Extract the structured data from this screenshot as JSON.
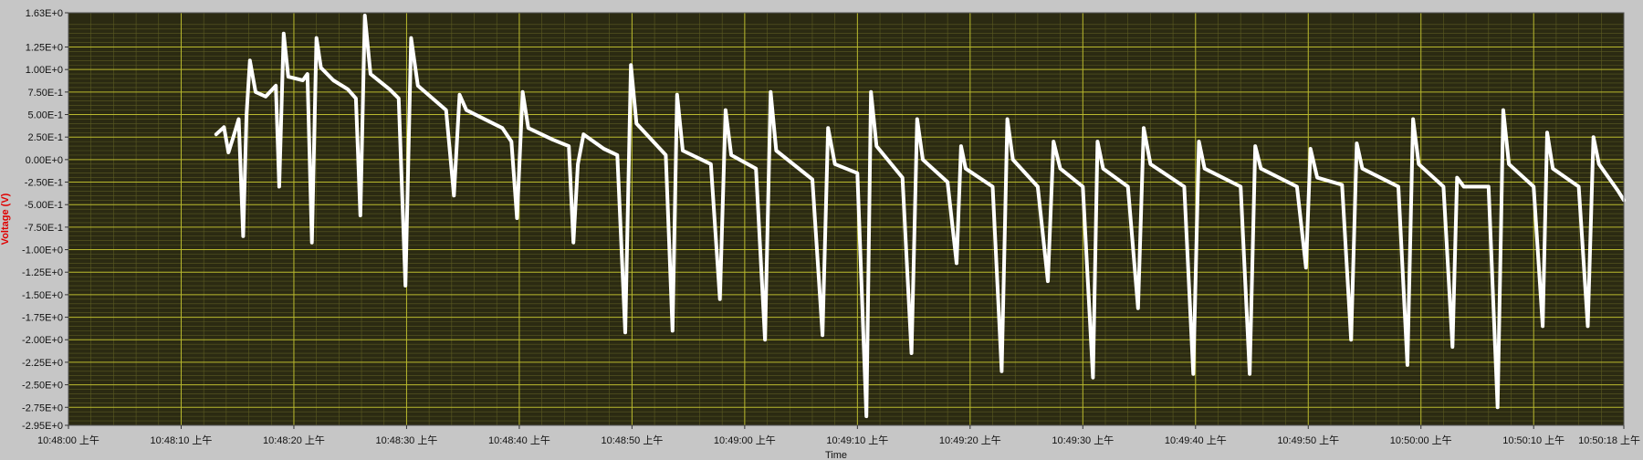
{
  "chart_data": {
    "type": "line",
    "title": "",
    "xlabel": "Time",
    "ylabel": "Voltage (V)",
    "ylim": [
      -2.95,
      1.63
    ],
    "xlim": [
      "10:48:00 上午",
      "10:50:18 上午"
    ],
    "grid": true,
    "legend": "none",
    "y_tick_values": [
      1.63,
      1.25,
      1.0,
      0.75,
      0.5,
      0.25,
      0.0,
      -0.25,
      -0.5,
      -0.75,
      -1.0,
      -1.25,
      -1.5,
      -1.75,
      -2.0,
      -2.25,
      -2.5,
      -2.75,
      -2.95
    ],
    "y_tick_labels": [
      "1.63E+0",
      "1.25E+0",
      "1.00E+0",
      "7.50E-1",
      "5.00E-1",
      "2.50E-1",
      "0.00E+0",
      "-2.50E-1",
      "-5.00E-1",
      "-7.50E-1",
      "-1.00E+0",
      "-1.25E+0",
      "-1.50E+0",
      "-1.75E+0",
      "-2.00E+0",
      "-2.25E+0",
      "-2.50E+0",
      "-2.75E+0",
      "-2.95E+0"
    ],
    "x_tick_labels": [
      "10:48:00 上午",
      "10:48:10 上午",
      "10:48:20 上午",
      "10:48:30 上午",
      "10:48:40 上午",
      "10:48:50 上午",
      "10:49:00 上午",
      "10:49:10 上午",
      "10:49:20 上午",
      "10:49:30 上午",
      "10:49:40 上午",
      "10:49:50 上午",
      "10:50:00 上午",
      "10:50:10 上午",
      "10:50:18 上午"
    ],
    "x_tick_seconds": [
      0,
      10,
      20,
      30,
      40,
      50,
      60,
      70,
      80,
      90,
      100,
      110,
      120,
      130,
      138
    ],
    "series": [
      {
        "color": "#ffffff",
        "start_value": 0.3,
        "end_value": -0.45,
        "points": [
          [
            13.1,
            0.28
          ],
          [
            13.8,
            0.36
          ],
          [
            14.2,
            0.08
          ],
          [
            14.6,
            0.24
          ],
          [
            15.1,
            0.45
          ],
          [
            15.5,
            -0.85
          ],
          [
            15.8,
            0.5
          ],
          [
            16.1,
            1.1
          ],
          [
            16.6,
            0.75
          ],
          [
            17.5,
            0.7
          ],
          [
            18.4,
            0.82
          ],
          [
            18.7,
            -0.3
          ],
          [
            19.1,
            1.4
          ],
          [
            19.5,
            0.92
          ],
          [
            20.8,
            0.88
          ],
          [
            21.2,
            0.95
          ],
          [
            21.6,
            -0.92
          ],
          [
            22.0,
            1.35
          ],
          [
            22.4,
            1.02
          ],
          [
            23.5,
            0.88
          ],
          [
            24.8,
            0.78
          ],
          [
            25.5,
            0.68
          ],
          [
            25.9,
            -0.62
          ],
          [
            26.3,
            1.6
          ],
          [
            26.8,
            0.95
          ],
          [
            28.5,
            0.78
          ],
          [
            29.3,
            0.68
          ],
          [
            29.9,
            -1.4
          ],
          [
            30.4,
            1.35
          ],
          [
            31.0,
            0.82
          ],
          [
            33.5,
            0.55
          ],
          [
            34.2,
            -0.4
          ],
          [
            34.7,
            0.72
          ],
          [
            35.3,
            0.55
          ],
          [
            38.5,
            0.35
          ],
          [
            39.3,
            0.2
          ],
          [
            39.8,
            -0.65
          ],
          [
            40.3,
            0.75
          ],
          [
            40.8,
            0.35
          ],
          [
            43.0,
            0.22
          ],
          [
            44.4,
            0.15
          ],
          [
            44.8,
            -0.92
          ],
          [
            45.2,
            -0.05
          ],
          [
            45.7,
            0.28
          ],
          [
            47.5,
            0.12
          ],
          [
            48.7,
            0.05
          ],
          [
            49.4,
            -1.92
          ],
          [
            49.9,
            1.05
          ],
          [
            50.4,
            0.4
          ],
          [
            53.0,
            0.05
          ],
          [
            53.6,
            -1.9
          ],
          [
            54.0,
            0.72
          ],
          [
            54.5,
            0.1
          ],
          [
            57.0,
            -0.05
          ],
          [
            57.8,
            -1.55
          ],
          [
            58.3,
            0.55
          ],
          [
            58.8,
            0.05
          ],
          [
            61.0,
            -0.1
          ],
          [
            61.8,
            -2.0
          ],
          [
            62.3,
            0.75
          ],
          [
            62.8,
            0.1
          ],
          [
            66.0,
            -0.22
          ],
          [
            66.9,
            -1.95
          ],
          [
            67.4,
            0.35
          ],
          [
            68.0,
            -0.05
          ],
          [
            70.0,
            -0.15
          ],
          [
            70.8,
            -2.85
          ],
          [
            71.2,
            0.75
          ],
          [
            71.7,
            0.15
          ],
          [
            74.0,
            -0.2
          ],
          [
            74.8,
            -2.15
          ],
          [
            75.3,
            0.45
          ],
          [
            75.8,
            0.0
          ],
          [
            78.0,
            -0.25
          ],
          [
            78.8,
            -1.15
          ],
          [
            79.2,
            0.15
          ],
          [
            79.6,
            -0.1
          ],
          [
            82.0,
            -0.3
          ],
          [
            82.8,
            -2.35
          ],
          [
            83.3,
            0.45
          ],
          [
            83.8,
            0.0
          ],
          [
            86.0,
            -0.3
          ],
          [
            86.9,
            -1.35
          ],
          [
            87.4,
            0.2
          ],
          [
            88.0,
            -0.1
          ],
          [
            90.0,
            -0.3
          ],
          [
            90.9,
            -2.42
          ],
          [
            91.3,
            0.2
          ],
          [
            91.8,
            -0.1
          ],
          [
            94.0,
            -0.3
          ],
          [
            94.9,
            -1.65
          ],
          [
            95.4,
            0.35
          ],
          [
            96.0,
            -0.05
          ],
          [
            99.0,
            -0.3
          ],
          [
            99.8,
            -2.38
          ],
          [
            100.3,
            0.2
          ],
          [
            100.8,
            -0.1
          ],
          [
            104.0,
            -0.3
          ],
          [
            104.8,
            -2.38
          ],
          [
            105.3,
            0.15
          ],
          [
            105.8,
            -0.1
          ],
          [
            109.0,
            -0.3
          ],
          [
            109.8,
            -1.2
          ],
          [
            110.2,
            0.12
          ],
          [
            110.8,
            -0.2
          ],
          [
            113.0,
            -0.28
          ],
          [
            113.8,
            -2.0
          ],
          [
            114.3,
            0.18
          ],
          [
            114.8,
            -0.1
          ],
          [
            118.0,
            -0.3
          ],
          [
            118.8,
            -2.28
          ],
          [
            119.3,
            0.45
          ],
          [
            119.8,
            -0.05
          ],
          [
            122.0,
            -0.3
          ],
          [
            122.8,
            -2.08
          ],
          [
            123.2,
            -0.2
          ],
          [
            123.8,
            -0.3
          ],
          [
            126.0,
            -0.3
          ],
          [
            126.8,
            -2.75
          ],
          [
            127.3,
            0.55
          ],
          [
            127.8,
            -0.05
          ],
          [
            130.0,
            -0.3
          ],
          [
            130.8,
            -1.85
          ],
          [
            131.2,
            0.3
          ],
          [
            131.7,
            -0.1
          ],
          [
            134.0,
            -0.3
          ],
          [
            134.8,
            -1.85
          ],
          [
            135.3,
            0.25
          ],
          [
            135.8,
            -0.05
          ],
          [
            137.5,
            -0.35
          ],
          [
            138.0,
            -0.45
          ]
        ]
      }
    ]
  }
}
